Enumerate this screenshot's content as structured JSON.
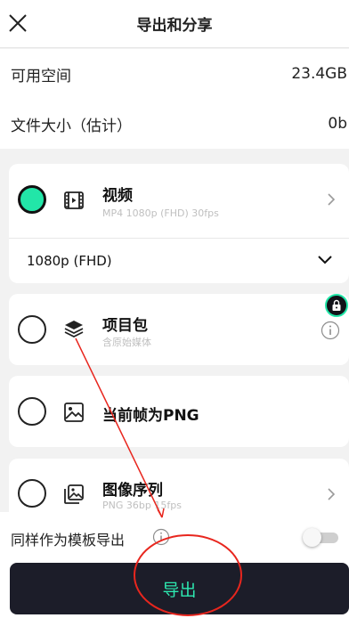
{
  "header": {
    "title": "导出和分享",
    "close_icon": "close-icon"
  },
  "info": {
    "space_label": "可用空间",
    "space_value": "23.4GB",
    "size_label": "文件大小（估计）",
    "size_value": "0b"
  },
  "options": {
    "video": {
      "title": "视频",
      "subtitle": "MP4 1080p (FHD) 30fps",
      "selected": true,
      "icon": "film-icon"
    },
    "resolution": {
      "value": "1080p (FHD)",
      "icon": "chevron-down-icon"
    },
    "project": {
      "title": "项目包",
      "subtitle": "含原始媒体",
      "selected": false,
      "icon": "layers-icon"
    },
    "png": {
      "title": "当前帧为PNG",
      "selected": false,
      "icon": "image-icon"
    },
    "sequence": {
      "title": "图像序列",
      "subtitle": "PNG 36bp 15fps",
      "selected": false,
      "icon": "image-stack-icon"
    }
  },
  "template": {
    "label": "同样作为模板导出",
    "enabled": false
  },
  "export_button": {
    "label": "导出"
  },
  "colors": {
    "accent": "#22e6a8",
    "button_bg": "#1c1d29",
    "annotation": "#e8261e"
  }
}
